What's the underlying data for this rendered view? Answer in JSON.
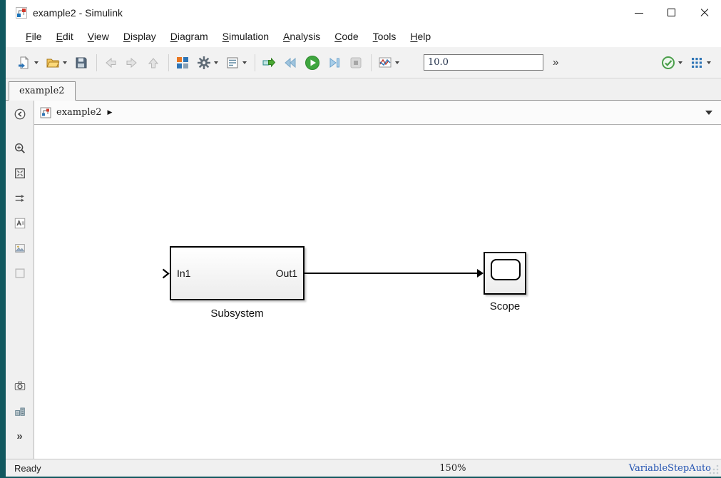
{
  "window": {
    "title": "example2 - Simulink"
  },
  "menubar": {
    "items": [
      {
        "label": "File"
      },
      {
        "label": "Edit"
      },
      {
        "label": "View"
      },
      {
        "label": "Display"
      },
      {
        "label": "Diagram"
      },
      {
        "label": "Simulation"
      },
      {
        "label": "Analysis"
      },
      {
        "label": "Code"
      },
      {
        "label": "Tools"
      },
      {
        "label": "Help"
      }
    ]
  },
  "toolbar": {
    "stop_time_value": "10.0",
    "overflow_glyph": "»",
    "icons": [
      "new-model",
      "open-model",
      "save-model",
      "navigate-back",
      "navigate-forward",
      "navigate-up",
      "library-browser",
      "model-configuration",
      "model-data-editor",
      "update-diagram",
      "step-back",
      "run",
      "step-forward",
      "stop",
      "simulation-data-inspector",
      "model-advisor-check",
      "target-hardware"
    ]
  },
  "tabbar": {
    "tabs": [
      {
        "label": "example2",
        "active": true
      }
    ]
  },
  "breadcrumb": {
    "model": "example2",
    "separator_glyph": "▶"
  },
  "sidebar": {
    "items": [
      "show-explorer-bar",
      "zoom-in",
      "fit-to-view",
      "sample-time-arrows",
      "annotation",
      "image",
      "area-box",
      "viewmark-camera",
      "library-blocks",
      "more-tools"
    ],
    "more_glyph": "»"
  },
  "canvas": {
    "blocks": [
      {
        "type": "subsystem",
        "label": "Subsystem",
        "in_port": "In1",
        "out_port": "Out1"
      },
      {
        "type": "scope",
        "label": "Scope"
      }
    ],
    "connection": {
      "from": "Subsystem/Out1",
      "to": "Scope/In1"
    }
  },
  "statusbar": {
    "status": "Ready",
    "zoom": "150%",
    "solver": "VariableStepAuto"
  }
}
